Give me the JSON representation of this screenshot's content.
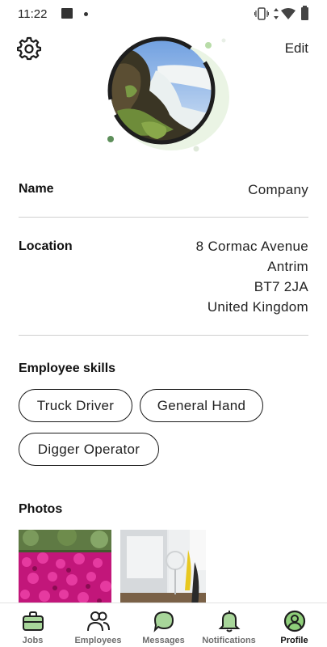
{
  "status_bar": {
    "time": "11:22"
  },
  "header": {
    "edit_label": "Edit"
  },
  "profile": {
    "name_label": "Name",
    "name_value": "Company",
    "location_label": "Location",
    "address": [
      "8 Cormac Avenue",
      "Antrim",
      "BT7 2JA",
      "United Kingdom"
    ]
  },
  "skills": {
    "title": "Employee skills",
    "items": [
      "Truck Driver",
      "General Hand",
      "Digger Operator"
    ]
  },
  "photos": {
    "title": "Photos"
  },
  "tabs": [
    {
      "label": "Jobs",
      "icon": "briefcase-icon",
      "active": false
    },
    {
      "label": "Employees",
      "icon": "people-icon",
      "active": false
    },
    {
      "label": "Messages",
      "icon": "chat-bubble-icon",
      "active": false
    },
    {
      "label": "Notifications",
      "icon": "bell-icon",
      "active": false
    },
    {
      "label": "Profile",
      "icon": "profile-icon",
      "active": true
    }
  ],
  "colors": {
    "accent_green": "#9ccc8a",
    "tab_icon_green": "#8fcf7a",
    "text": "#1a1a1a"
  }
}
